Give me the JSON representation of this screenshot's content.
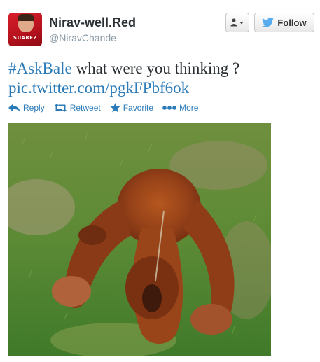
{
  "user": {
    "display_name": "Nirav-well.Red",
    "handle": "@NiravChande",
    "avatar_text": "SUAREZ"
  },
  "buttons": {
    "follow_label": "Follow",
    "user_actions_icon": "user-dropdown-icon"
  },
  "tweet": {
    "hashtag": "#AskBale",
    "text": " what were you thinking ?",
    "link": "pic.twitter.com/pgkFPbf6ok"
  },
  "actions": {
    "reply": "Reply",
    "retweet": "Retweet",
    "favorite": "Favorite",
    "more": "More"
  },
  "colors": {
    "link": "#2b7bb9",
    "name": "#292f33",
    "handle": "#8899a6",
    "twitter_bird": "#55acee"
  }
}
